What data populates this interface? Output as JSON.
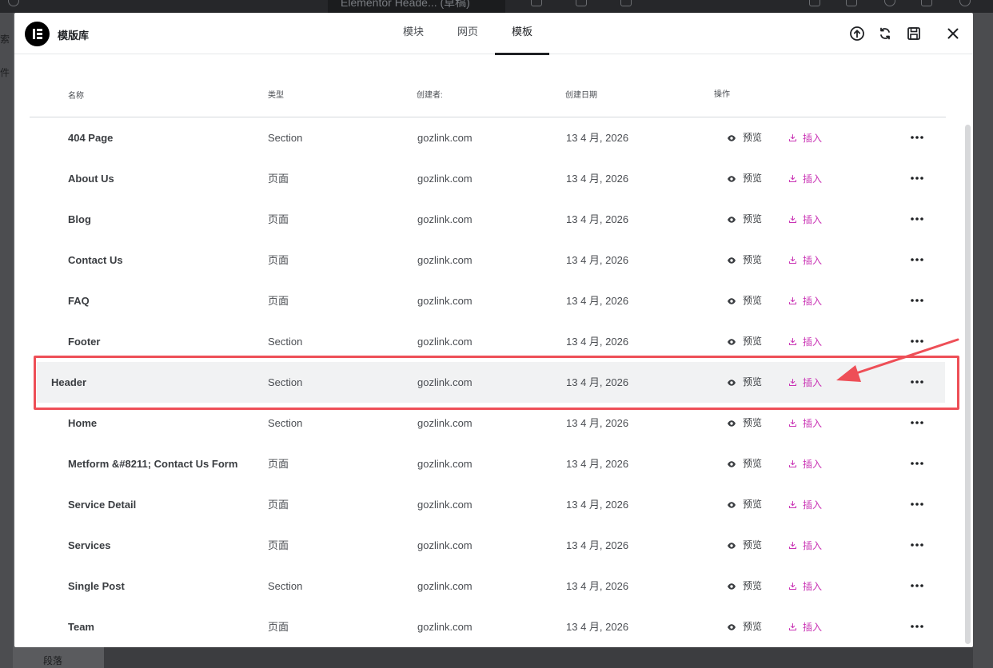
{
  "background": {
    "doc_title": "Elementor Heade... (草稿)",
    "left_labels": [
      "索",
      "件"
    ],
    "bottom_label": "段落"
  },
  "library": {
    "title": "模版库",
    "tabs": [
      {
        "label": "模块",
        "active": false
      },
      {
        "label": "网页",
        "active": false
      },
      {
        "label": "模板",
        "active": true
      }
    ]
  },
  "table": {
    "headers": {
      "name": "名称",
      "type": "类型",
      "creator": "创建者:",
      "date": "创建日期",
      "actions": "操作"
    },
    "preview_label": "预览",
    "insert_label": "插入",
    "rows": [
      {
        "name": "404 Page",
        "type": "Section",
        "creator": "gozlink.com",
        "date": "13 4 月, 2026"
      },
      {
        "name": "About Us",
        "type": "页面",
        "creator": "gozlink.com",
        "date": "13 4 月, 2026"
      },
      {
        "name": "Blog",
        "type": "页面",
        "creator": "gozlink.com",
        "date": "13 4 月, 2026"
      },
      {
        "name": "Contact Us",
        "type": "页面",
        "creator": "gozlink.com",
        "date": "13 4 月, 2026"
      },
      {
        "name": "FAQ",
        "type": "页面",
        "creator": "gozlink.com",
        "date": "13 4 月, 2026"
      },
      {
        "name": "Footer",
        "type": "Section",
        "creator": "gozlink.com",
        "date": "13 4 月, 2026"
      },
      {
        "name": "Header",
        "type": "Section",
        "creator": "gozlink.com",
        "date": "13 4 月, 2026",
        "highlighted": true
      },
      {
        "name": "Home",
        "type": "Section",
        "creator": "gozlink.com",
        "date": "13 4 月, 2026"
      },
      {
        "name": "Metform &#8211; Contact Us Form",
        "type": "页面",
        "creator": "gozlink.com",
        "date": "13 4 月, 2026"
      },
      {
        "name": "Service Detail",
        "type": "页面",
        "creator": "gozlink.com",
        "date": "13 4 月, 2026"
      },
      {
        "name": "Services",
        "type": "页面",
        "creator": "gozlink.com",
        "date": "13 4 月, 2026"
      },
      {
        "name": "Single Post",
        "type": "Section",
        "creator": "gozlink.com",
        "date": "13 4 月, 2026"
      },
      {
        "name": "Team",
        "type": "页面",
        "creator": "gozlink.com",
        "date": "13 4 月, 2026"
      }
    ]
  },
  "colors": {
    "accent_insert": "#c932b4",
    "annotation_red": "#ee4f57"
  },
  "icons": [
    "elementor-logo-icon",
    "upload-icon",
    "sync-icon",
    "save-icon",
    "close-icon",
    "eye-icon",
    "download-icon",
    "more-icon"
  ]
}
